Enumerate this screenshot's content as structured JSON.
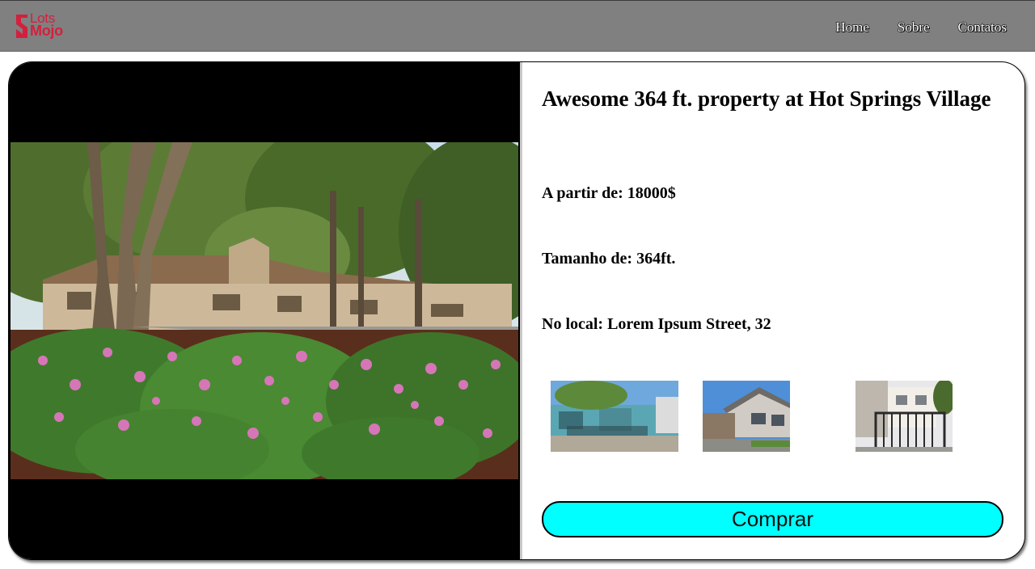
{
  "brand": {
    "line1": "Lots",
    "line2": "Mojo",
    "color": "#d41f3d"
  },
  "nav": {
    "items": [
      "Home",
      "Sobre",
      "Contatos"
    ]
  },
  "listing": {
    "title": "Awesome 364 ft. property at Hot Springs Village",
    "price": "A partir de: 18000$",
    "size": "Tamanho de: 364ft.",
    "location": "No local: Lorem Ipsum Street, 32",
    "buy_label": "Comprar"
  },
  "colors": {
    "navbar": "#808080",
    "buy_button": "#00ffff",
    "photo_frame": "#000000"
  },
  "icons": {
    "logo": "lotsmojo-logo",
    "thumbnails": [
      "house-blue-thumb",
      "house-gray-thumb",
      "house-gate-thumb"
    ]
  }
}
